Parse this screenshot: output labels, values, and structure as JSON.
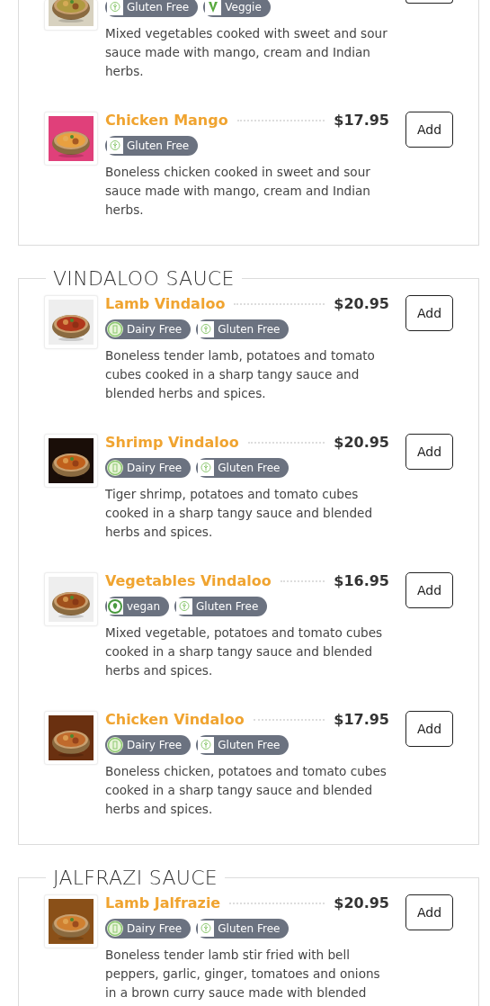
{
  "sections": [
    {
      "items": [
        {
          "kind": "partial",
          "badges": [
            {
              "kind": "gluten",
              "label": "Gluten Free"
            },
            {
              "kind": "veggie",
              "label": "Veggie"
            }
          ],
          "description": "Mixed vegetables cooked with sweet and sour sauce made with mango, cream and Indian herbs."
        },
        {
          "kind": "full",
          "name": "Chicken Mango",
          "price": "$17.95",
          "button": "Add",
          "badges": [
            {
              "kind": "gluten",
              "label": "Gluten Free"
            }
          ],
          "description": "Boneless chicken cooked in sweet and sour sauce made with mango, cream and Indian herbs."
        }
      ]
    },
    {
      "title": "VINDALOO SAUCE",
      "items": [
        {
          "kind": "full",
          "name": "Lamb Vindaloo",
          "price": "$20.95",
          "button": "Add",
          "badges": [
            {
              "kind": "dairy",
              "label": "Dairy Free"
            },
            {
              "kind": "gluten",
              "label": "Gluten Free"
            }
          ],
          "description": "Boneless tender lamb, potatoes and tomato cubes cooked in a sharp tangy sauce and blended herbs and spices."
        },
        {
          "kind": "full",
          "name": "Shrimp Vindaloo",
          "price": "$20.95",
          "button": "Add",
          "badges": [
            {
              "kind": "dairy",
              "label": "Dairy Free"
            },
            {
              "kind": "gluten",
              "label": "Gluten Free"
            }
          ],
          "description": "Tiger shrimp, potatoes and tomato cubes cooked in a sharp tangy sauce and blended herbs and spices."
        },
        {
          "kind": "full",
          "name": "Vegetables Vindaloo",
          "price": "$16.95",
          "button": "Add",
          "badges": [
            {
              "kind": "vegan",
              "label": "vegan"
            },
            {
              "kind": "gluten",
              "label": "Gluten Free"
            }
          ],
          "description": "Mixed vegetable, potatoes and tomato cubes cooked in a sharp tangy sauce and blended herbs and spices."
        },
        {
          "kind": "full",
          "name": "Chicken Vindaloo",
          "price": "$17.95",
          "button": "Add",
          "badges": [
            {
              "kind": "dairy",
              "label": "Dairy Free"
            },
            {
              "kind": "gluten",
              "label": "Gluten Free"
            }
          ],
          "description": "Boneless chicken, potatoes and tomato cubes cooked in a sharp tangy sauce and blended herbs and spices."
        }
      ]
    },
    {
      "title": "JALFRAZI SAUCE",
      "items": [
        {
          "kind": "full",
          "name": "Lamb Jalfrazie",
          "price": "$20.95",
          "button": "Add",
          "badges": [
            {
              "kind": "dairy",
              "label": "Dairy Free"
            },
            {
              "kind": "gluten",
              "label": "Gluten Free"
            }
          ],
          "description": "Boneless tender lamb stir fried with bell peppers, garlic, ginger, tomatoes and onions in a brown curry sauce made with blended"
        }
      ]
    }
  ]
}
